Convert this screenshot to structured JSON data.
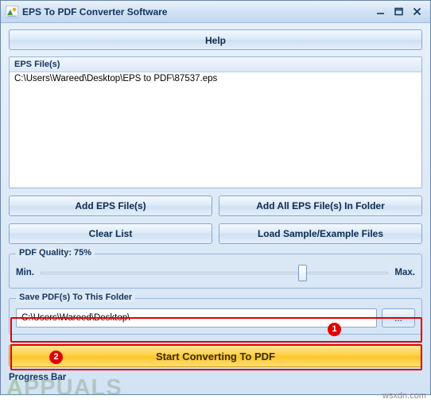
{
  "window": {
    "title": "EPS To PDF Converter Software",
    "icon": "app-icon",
    "buttons": {
      "minimize": "minimize-icon",
      "maximize": "maximize-icon",
      "close": "close-icon"
    }
  },
  "help_button": "Help",
  "file_list": {
    "header": "EPS File(s)",
    "rows": [
      "C:\\Users\\Wareed\\Desktop\\EPS to PDF\\87537.eps"
    ]
  },
  "actions": {
    "add_eps_files": "Add EPS File(s)",
    "add_all_in_folder": "Add All EPS File(s) In Folder",
    "clear_list": "Clear List",
    "load_samples": "Load Sample/Example Files"
  },
  "quality": {
    "legend": "PDF Quality: 75%",
    "min_label": "Min.",
    "max_label": "Max.",
    "value": 75
  },
  "save_folder": {
    "legend": "Save PDF(s) To This Folder",
    "value": "C:\\Users\\Wareed\\Desktop\\",
    "placeholder": "C:\\",
    "browse_label": "..."
  },
  "start_button": "Start Converting To PDF",
  "progress_label": "Progress Bar",
  "annotations": {
    "badge_1": "1",
    "badge_2": "2",
    "accent_color": "#e10000"
  },
  "watermarks": {
    "appuals_a": "A",
    "appuals_rest": "PPUALS",
    "site": "wsxdn.com"
  }
}
